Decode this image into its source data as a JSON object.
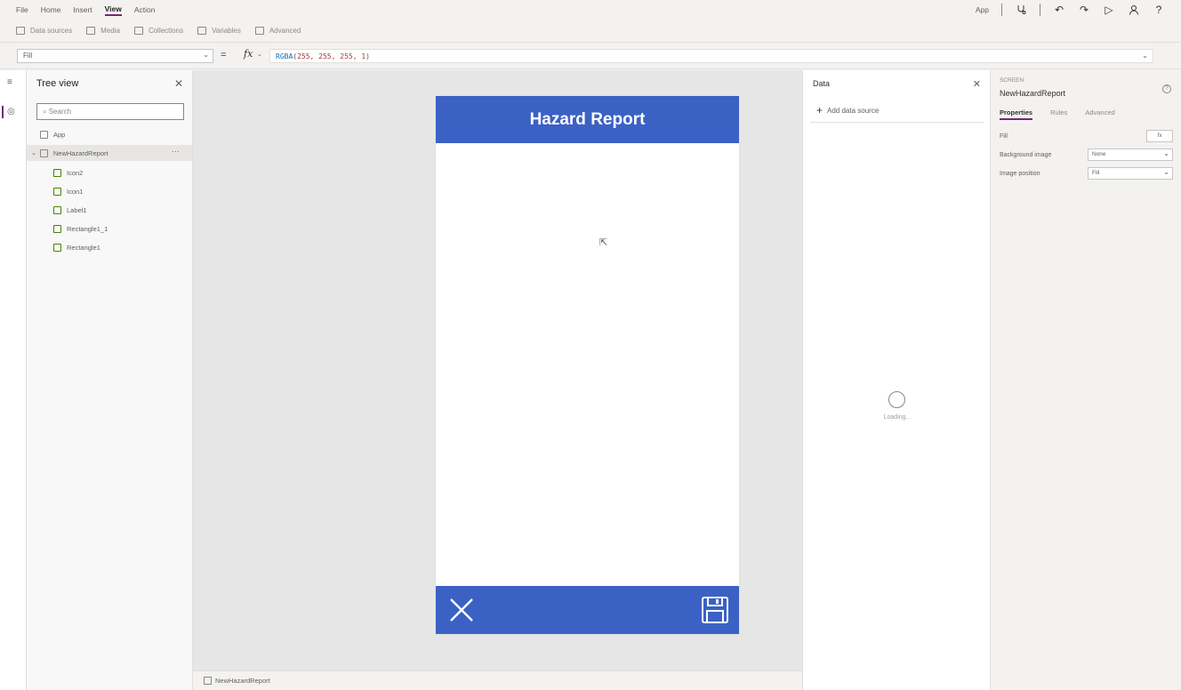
{
  "menubar": {
    "items": [
      "File",
      "Home",
      "Insert",
      "View",
      "Action"
    ],
    "active": "View",
    "right": {
      "app_label": "App"
    }
  },
  "toolbar": {
    "items": [
      "Data sources",
      "Media",
      "Collections",
      "Variables",
      "Advanced"
    ]
  },
  "formula_bar": {
    "property": "Fill",
    "equals": "=",
    "fx": "fx",
    "formula_fn": "RGBA",
    "formula_args": "(255, 255, 255, 1)"
  },
  "tree_view": {
    "title": "Tree view",
    "search_placeholder": "Search",
    "app_label": "App",
    "screen": "NewHazardReport",
    "children": [
      "Icon2",
      "Icon1",
      "Label1",
      "Rectangle1_1",
      "Rectangle1"
    ]
  },
  "canvas": {
    "header_title": "Hazard Report",
    "header_color": "#3b61c4",
    "status_screen": "NewHazardReport"
  },
  "data_pane": {
    "title": "Data",
    "add_label": "Add data source",
    "loading": "Loading..."
  },
  "properties_pane": {
    "kind": "SCREEN",
    "name": "NewHazardReport",
    "tabs": [
      "Properties",
      "Rules",
      "Advanced"
    ],
    "active_tab": "Properties",
    "fill_label": "Fill",
    "fill_value": "fx",
    "bg_image_label": "Background image",
    "bg_image_value": "None",
    "image_position_label": "Image position",
    "image_position_value": "Fill"
  },
  "colors": {
    "accent": "#742774",
    "app_blue": "#3b61c4"
  }
}
